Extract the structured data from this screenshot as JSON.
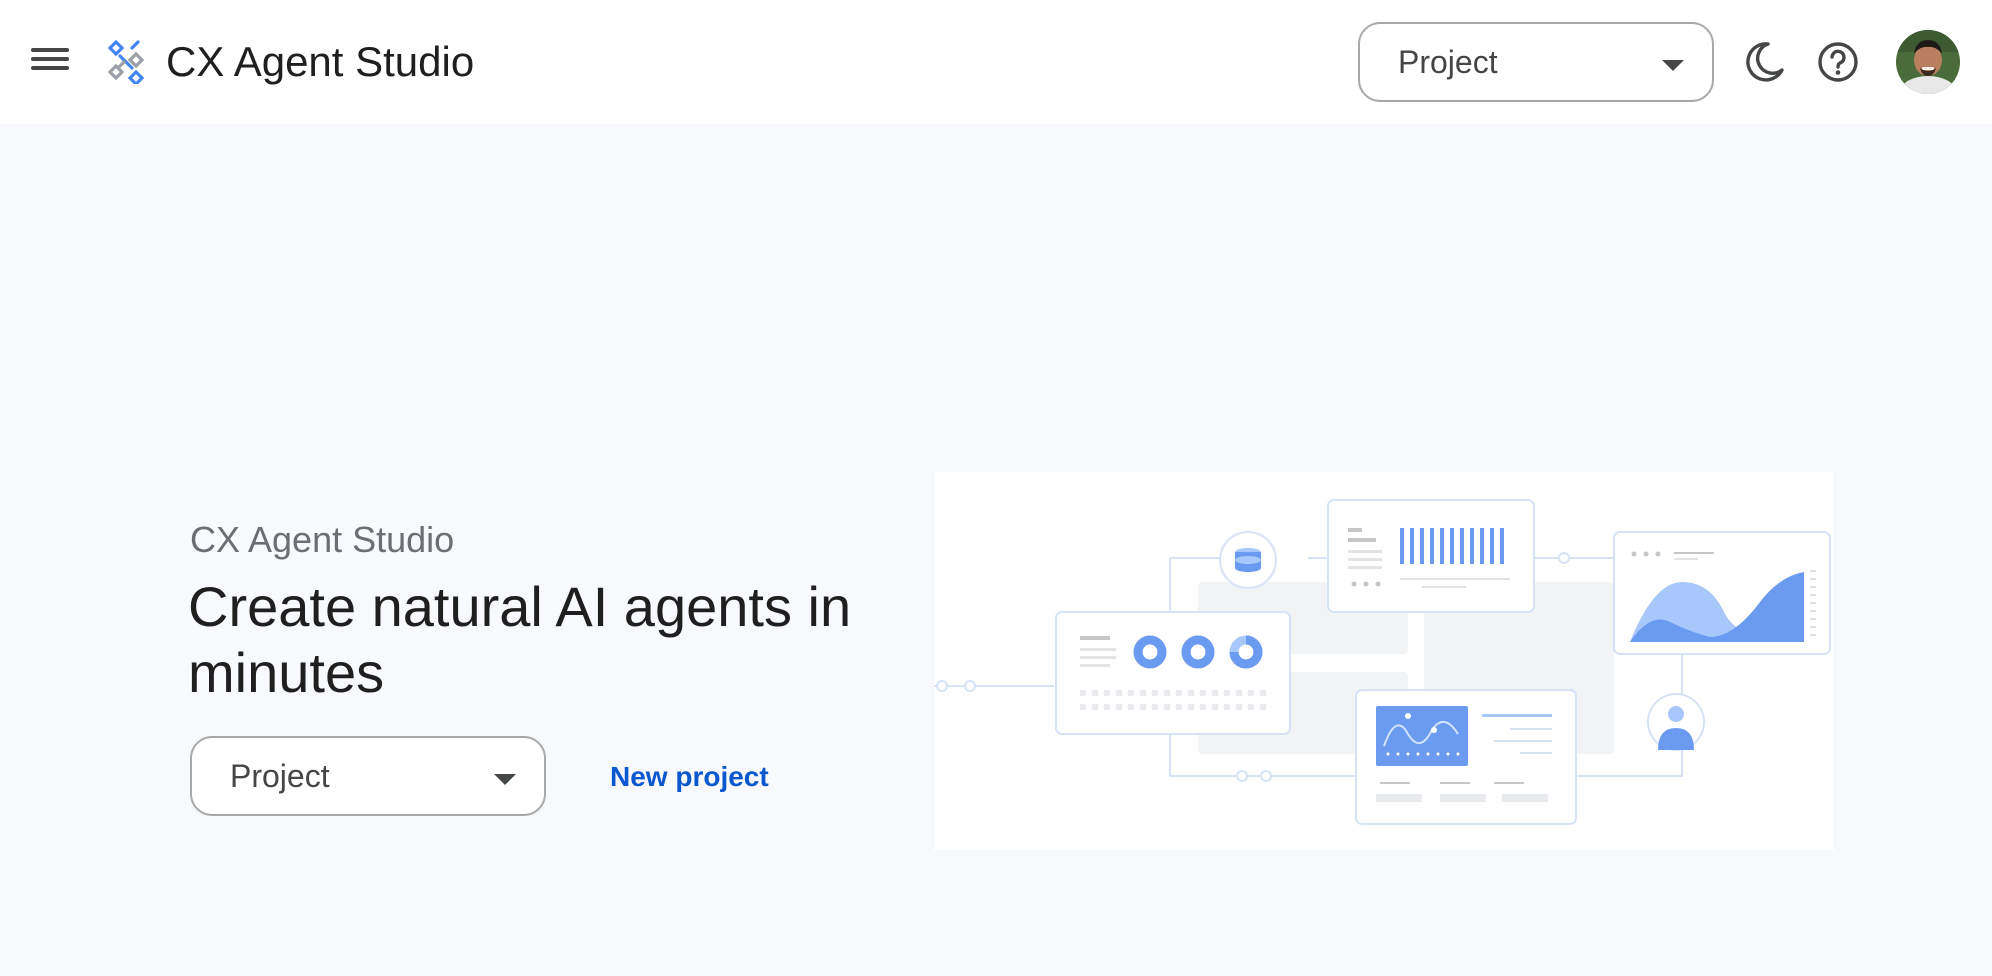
{
  "header": {
    "app_title": "CX Agent Studio",
    "project_select": {
      "selected_label": "Project"
    },
    "icons": {
      "menu": "menu-icon",
      "logo": "cx-agent-studio-logo-icon",
      "dark_mode": "moon-icon",
      "help": "help-icon",
      "avatar": "user-avatar"
    }
  },
  "hero": {
    "subtitle": "CX Agent Studio",
    "title": "Create natural AI agents in minutes",
    "project_select": {
      "selected_label": "Project"
    },
    "new_project_label": "New project"
  },
  "colors": {
    "accent": "#0b57d0",
    "illustration_blue": "#6a9bf0",
    "background": "#f8f9fc"
  }
}
